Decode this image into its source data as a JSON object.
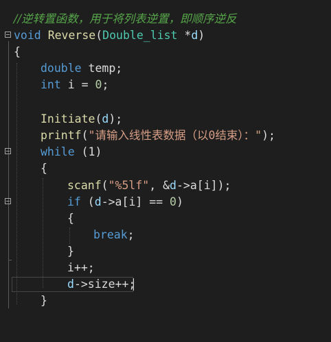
{
  "editor": {
    "comment": "//逆转置函数，用于将列表逆置，即顺序逆反",
    "signature": {
      "ret_type": "void",
      "func_name": "Reverse",
      "open_paren": "(",
      "param_type": "Double_list",
      "pointer": " *",
      "param_name": "d",
      "close_paren": ")"
    },
    "open_brace": "{",
    "decl1": {
      "type": "double",
      "name": "temp",
      "end": ";"
    },
    "decl2": {
      "type": "int",
      "name": "i",
      "assign": " = ",
      "value": "0",
      "end": ";"
    },
    "call_init": {
      "func": "Initiate",
      "open": "(",
      "arg": "d",
      "close": ");"
    },
    "call_printf": {
      "func": "printf",
      "open": "(",
      "str": "\"请输入线性表数据（以0结束）：\"",
      "close": ");"
    },
    "while_stmt": {
      "kw": "while",
      "cond": " (1)"
    },
    "inner_open": "{",
    "scanf_stmt": {
      "func": "scanf",
      "open": "(",
      "str": "\"%5lf\"",
      "rest_a": ", &",
      "d": "d",
      "rest_b": "->a[",
      "i": "i",
      "rest_c": "]);"
    },
    "if_stmt": {
      "kw": "if",
      "open": " (",
      "d": "d",
      "rest_a": "->a[",
      "i": "i",
      "rest_b": "] == ",
      "num": "0",
      "close": ")"
    },
    "if_open": "{",
    "break_stmt": {
      "kw": "break",
      "end": ";"
    },
    "if_close": "}",
    "incr_stmt": {
      "var": "i",
      "op": "++;"
    },
    "size_stmt": {
      "d": "d",
      "rest": "->size++;"
    },
    "inner_close": "}"
  }
}
